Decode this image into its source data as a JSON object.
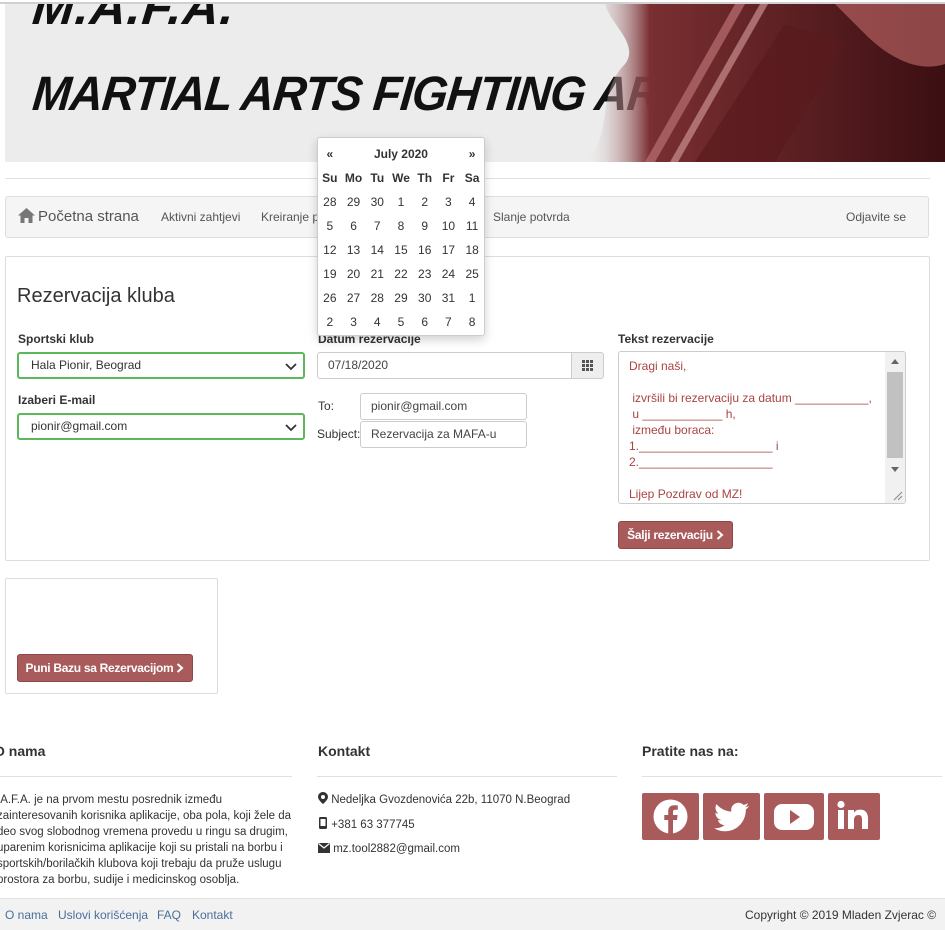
{
  "banner": {
    "title_line1": "M.A.F.A.",
    "title_line2": "MARTIAL ARTS FIGHTING AREA"
  },
  "navbar": {
    "brand": "Početna strana",
    "items": [
      "Aktivni zahtjevi",
      "Kreiranje p",
      "Slanje potvrda"
    ],
    "logout": "Odjavite se"
  },
  "form": {
    "heading": "Rezervacija kluba",
    "club_label": "Sportski klub",
    "club_value": "Hala Pionir, Beograd",
    "email_label": "Izaberi E-mail",
    "email_value": "pionir@gmail.com",
    "date_label": "Datum rezervacije",
    "date_value": "07/18/2020",
    "to_label": "To:",
    "to_value": "pionir@gmail.com",
    "subject_label": "Subject:",
    "subject_value": "Rezervacija za MAFA-u",
    "text_label": "Tekst rezervacije",
    "text_value": "Dragi naši,\n\n izvršili bi rezervaciju za datum ___________,\n u ____________ h,\n između boraca:\n1.____________________ i\n2.____________________\n\nLijep Pozdrav od MZ!",
    "send_button": "Šalji rezervaciju",
    "fill_button": "Puni Bazu sa Rezervacijom"
  },
  "datepicker": {
    "prev": "«",
    "next": "»",
    "month": "July 2020",
    "weekdays": [
      "Su",
      "Mo",
      "Tu",
      "We",
      "Th",
      "Fr",
      "Sa"
    ],
    "weeks": [
      [
        "28",
        "29",
        "30",
        "1",
        "2",
        "3",
        "4"
      ],
      [
        "5",
        "6",
        "7",
        "8",
        "9",
        "10",
        "11"
      ],
      [
        "12",
        "13",
        "14",
        "15",
        "16",
        "17",
        "18"
      ],
      [
        "19",
        "20",
        "21",
        "22",
        "23",
        "24",
        "25"
      ],
      [
        "26",
        "27",
        "28",
        "29",
        "30",
        "31",
        "1"
      ],
      [
        "2",
        "3",
        "4",
        "5",
        "6",
        "7",
        "8"
      ]
    ]
  },
  "footer": {
    "about_heading": "O nama",
    "about_text": ".A.F.A. je na prvom mestu posrednik između\nzainteresovanih korisnika aplikacije, oba pola, koji žele da\ndeo svog slobodnog vremena provedu u ringu sa drugim,\nuparenim korisnicima aplikacije koji su pristali na borbu i\nsportskih/borilačkih klubova koji trebaju da pruže uslugu\nprostora za borbu, sudije i medicinskog osoblja.",
    "contact_heading": "Kontakt",
    "address": "Nedeljka Gvozdenovića 22b, 11070 N.Beograd",
    "phone": "+381 63 377745",
    "email": "mz.tool2882@gmail.com",
    "follow_heading": "Pratite nas na:",
    "social": [
      "facebook-icon",
      "twitter-icon",
      "youtube-icon",
      "linkedin-icon"
    ],
    "links": [
      "O nama",
      "Uslovi korišćenja",
      "FAQ",
      "Kontakt"
    ],
    "copyright": "Copyright © 2019 Mladen Zvjerac ©"
  },
  "colors": {
    "accent": "#a95b5b",
    "valid_border": "#5cb85c",
    "textarea_text": "#a94442",
    "link": "#4a6f9a"
  }
}
